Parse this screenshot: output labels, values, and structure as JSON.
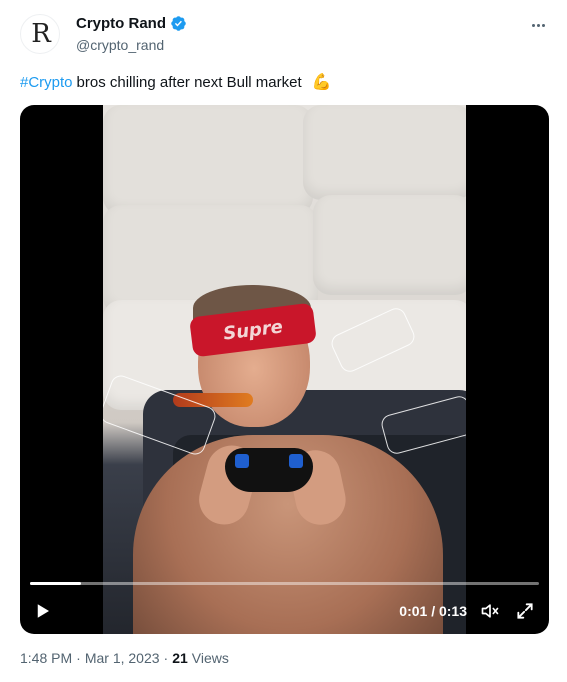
{
  "author": {
    "avatar_letter": "R",
    "display_name": "Crypto Rand",
    "handle": "@crypto_rand",
    "verified": true
  },
  "tweet": {
    "hashtag": "#Crypto",
    "text": "bros chilling after next Bull market",
    "emoji": "💪"
  },
  "video": {
    "headband_text": "Supre",
    "current_time": "0:01",
    "duration": "0:13",
    "time_display": "0:01 / 0:13",
    "progress_fraction": 0.1,
    "muted": true
  },
  "meta": {
    "time": "1:48 PM",
    "date": "Mar 1, 2023",
    "separator": "·",
    "views_count": "21",
    "views_label": "Views"
  },
  "colors": {
    "link": "#1d9bf0",
    "verified": "#1d9bf0",
    "secondary_text": "#536471"
  },
  "icons": {
    "verified": "verified-badge-icon",
    "more": "more-options-icon",
    "play": "play-icon",
    "mute": "volume-muted-icon",
    "fullscreen": "fullscreen-icon"
  }
}
